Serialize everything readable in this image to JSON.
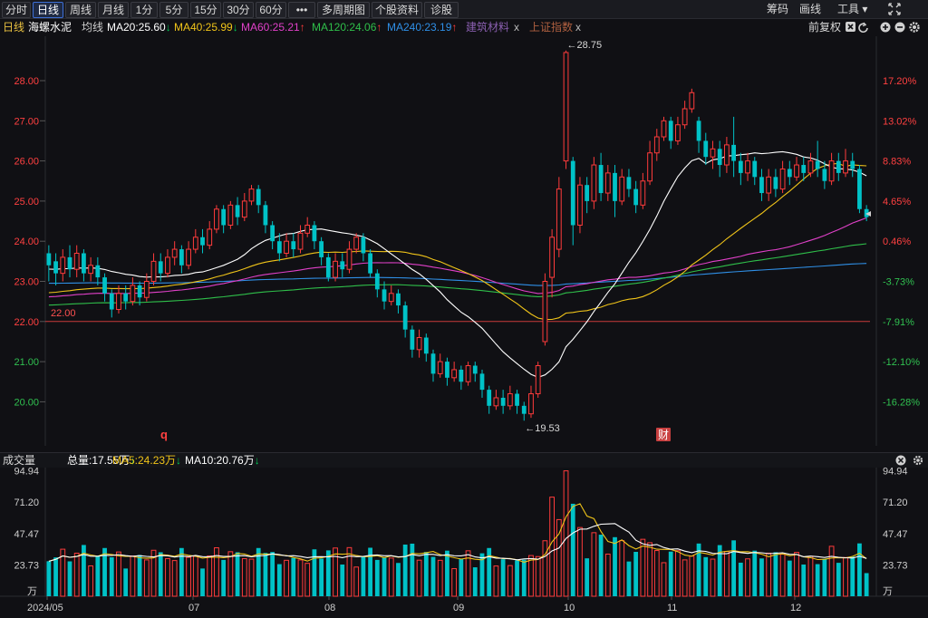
{
  "toolbar": {
    "left_buttons": [
      "分时",
      "日线",
      "周线",
      "月线",
      "1分",
      "5分",
      "15分",
      "30分",
      "60分",
      "•••",
      "多周期图 ▾",
      "个股资料",
      "诊股"
    ],
    "active_index": 1,
    "right_items": [
      "筹码",
      "画线",
      "工具 ▾"
    ],
    "expand_icon": "expand-arrows-icon"
  },
  "info": {
    "period": "日线",
    "stock_name": "海螺水泥",
    "ma_label": "均线",
    "ma20": "MA20:25.60",
    "ma20_arrow": "↓",
    "ma40": "MA40:25.99",
    "ma40_arrow": "↓",
    "ma60": "MA60:25.21",
    "ma60_arrow": "↑",
    "ma120": "MA120:24.06",
    "ma120_arrow": "↑",
    "ma240": "MA240:23.19",
    "ma240_arrow": "↑",
    "overlay1": "建筑材料",
    "overlay1_close": "x",
    "overlay2": "上证指数",
    "overlay2_close": "x",
    "adjust": "前复权",
    "colors": {
      "ma20": "#ffffff",
      "ma40": "#f0c419",
      "ma60": "#e040c8",
      "ma120": "#2fbf4a",
      "ma240": "#2f8fe6",
      "up": "#ff3b3b",
      "down": "#00c2c7"
    }
  },
  "price_axis": {
    "left_labels": [
      "28.00",
      "27.00",
      "26.00",
      "25.00",
      "24.00",
      "23.00",
      "22.00",
      "21.00",
      "20.00"
    ],
    "right_labels": [
      "17.20%",
      "13.02%",
      "8.83%",
      "4.65%",
      "0.46%",
      "-3.73%",
      "-7.91%",
      "-12.10%",
      "-16.28%"
    ],
    "ref_line": "22.00",
    "high_marker": "←28.75",
    "low_marker": "←19.53",
    "q_marker": "q",
    "cai_marker": "财"
  },
  "volume": {
    "title": "成交量",
    "total": "总量:17.55万",
    "total_arrow": "↓",
    "ma5": "MA5:24.23万",
    "ma5_arrow": "↓",
    "ma10": "MA10:20.76万",
    "ma10_arrow": "↓",
    "axis_labels": [
      "94.94",
      "71.20",
      "47.47",
      "23.73",
      "万"
    ]
  },
  "x_axis": [
    "2024/05",
    "07",
    "08",
    "09",
    "10",
    "11",
    "12"
  ],
  "chart_data": {
    "type": "candlestick",
    "title": "海螺水泥",
    "ylim": [
      19.4,
      29.0
    ],
    "reference_line": 22.0,
    "high": 28.75,
    "low": 19.53,
    "candles": [
      [
        23.7,
        23.4,
        23.9,
        23.0
      ],
      [
        23.5,
        23.2,
        23.7,
        22.9
      ],
      [
        23.2,
        23.6,
        23.8,
        23.0
      ],
      [
        23.6,
        23.3,
        23.9,
        23.1
      ],
      [
        23.3,
        23.7,
        23.9,
        23.1
      ],
      [
        23.7,
        23.2,
        23.8,
        23.0
      ],
      [
        23.2,
        23.4,
        23.6,
        23.0
      ],
      [
        23.4,
        23.1,
        23.6,
        22.9
      ],
      [
        23.1,
        22.7,
        23.2,
        22.5
      ],
      [
        22.7,
        22.3,
        22.8,
        22.1
      ],
      [
        22.3,
        22.7,
        22.9,
        22.2
      ],
      [
        22.7,
        22.5,
        22.9,
        22.3
      ],
      [
        22.5,
        22.9,
        23.1,
        22.4
      ],
      [
        22.9,
        22.6,
        23.0,
        22.4
      ],
      [
        22.6,
        23.0,
        23.2,
        22.5
      ],
      [
        23.0,
        23.5,
        23.7,
        22.9
      ],
      [
        23.5,
        23.2,
        23.7,
        23.0
      ],
      [
        23.2,
        23.6,
        23.8,
        23.1
      ],
      [
        23.6,
        23.8,
        24.0,
        23.4
      ],
      [
        23.8,
        23.4,
        23.9,
        23.2
      ],
      [
        23.4,
        23.8,
        24.0,
        23.3
      ],
      [
        23.8,
        24.1,
        24.3,
        23.7
      ],
      [
        24.1,
        23.9,
        24.3,
        23.7
      ],
      [
        23.9,
        24.3,
        24.5,
        23.8
      ],
      [
        24.3,
        24.8,
        24.9,
        24.2
      ],
      [
        24.8,
        24.4,
        24.9,
        24.2
      ],
      [
        24.4,
        24.9,
        25.0,
        24.3
      ],
      [
        24.9,
        24.6,
        25.1,
        24.4
      ],
      [
        24.6,
        25.0,
        25.2,
        24.5
      ],
      [
        25.0,
        25.3,
        25.4,
        24.9
      ],
      [
        25.3,
        24.9,
        25.4,
        24.7
      ],
      [
        24.9,
        24.4,
        25.0,
        24.2
      ],
      [
        24.4,
        24.0,
        24.5,
        23.8
      ],
      [
        24.0,
        23.7,
        24.2,
        23.5
      ],
      [
        23.7,
        24.0,
        24.2,
        23.6
      ],
      [
        24.0,
        23.8,
        24.2,
        23.6
      ],
      [
        23.8,
        24.2,
        24.4,
        23.7
      ],
      [
        24.2,
        24.4,
        24.6,
        24.1
      ],
      [
        24.4,
        24.0,
        24.5,
        23.8
      ],
      [
        24.0,
        23.6,
        24.1,
        23.4
      ],
      [
        23.6,
        23.1,
        23.7,
        23.0
      ],
      [
        23.1,
        23.5,
        23.7,
        23.0
      ],
      [
        23.5,
        23.3,
        23.7,
        23.1
      ],
      [
        23.3,
        23.8,
        24.0,
        23.2
      ],
      [
        23.8,
        24.1,
        24.2,
        23.7
      ],
      [
        24.1,
        23.7,
        24.2,
        23.5
      ],
      [
        23.7,
        23.2,
        23.8,
        23.1
      ],
      [
        23.2,
        22.8,
        23.3,
        22.6
      ],
      [
        22.8,
        22.5,
        23.0,
        22.3
      ],
      [
        22.5,
        22.7,
        22.9,
        22.4
      ],
      [
        22.7,
        22.4,
        22.8,
        22.2
      ],
      [
        22.4,
        21.8,
        22.5,
        21.6
      ],
      [
        21.8,
        21.3,
        21.9,
        21.1
      ],
      [
        21.3,
        21.6,
        21.8,
        21.1
      ],
      [
        21.6,
        21.2,
        21.7,
        21.0
      ],
      [
        21.2,
        20.7,
        21.3,
        20.5
      ],
      [
        20.7,
        21.0,
        21.2,
        20.6
      ],
      [
        21.0,
        20.6,
        21.1,
        20.4
      ],
      [
        20.6,
        20.8,
        21.0,
        20.5
      ],
      [
        20.8,
        20.5,
        20.9,
        20.3
      ],
      [
        20.5,
        20.9,
        21.0,
        20.4
      ],
      [
        20.9,
        20.7,
        21.0,
        20.5
      ],
      [
        20.7,
        20.3,
        20.8,
        20.1
      ],
      [
        20.3,
        19.9,
        20.4,
        19.7
      ],
      [
        19.9,
        20.1,
        20.3,
        19.8
      ],
      [
        20.1,
        19.9,
        20.3,
        19.7
      ],
      [
        19.9,
        20.2,
        20.4,
        19.8
      ],
      [
        20.2,
        19.9,
        20.3,
        19.7
      ],
      [
        19.9,
        19.7,
        20.0,
        19.53
      ],
      [
        19.7,
        20.2,
        20.4,
        19.6
      ],
      [
        20.2,
        20.9,
        21.0,
        20.1
      ],
      [
        21.5,
        23.0,
        23.2,
        21.4
      ],
      [
        23.1,
        24.1,
        24.3,
        22.6
      ],
      [
        23.8,
        25.3,
        25.6,
        23.6
      ],
      [
        26.0,
        28.7,
        28.75,
        25.8
      ],
      [
        26.0,
        24.4,
        26.1,
        23.9
      ],
      [
        24.4,
        25.4,
        25.6,
        24.2
      ],
      [
        25.4,
        25.0,
        25.6,
        24.7
      ],
      [
        25.0,
        25.9,
        26.1,
        24.8
      ],
      [
        25.9,
        25.2,
        26.2,
        25.0
      ],
      [
        25.2,
        25.7,
        25.9,
        25.0
      ],
      [
        25.7,
        25.0,
        25.9,
        24.6
      ],
      [
        25.0,
        25.6,
        25.8,
        24.9
      ],
      [
        25.6,
        25.3,
        25.8,
        25.1
      ],
      [
        25.3,
        24.9,
        25.5,
        24.7
      ],
      [
        24.9,
        25.5,
        25.7,
        24.8
      ],
      [
        25.5,
        26.2,
        26.5,
        25.4
      ],
      [
        26.2,
        26.6,
        26.8,
        26.0
      ],
      [
        26.6,
        27.0,
        27.1,
        26.5
      ],
      [
        27.0,
        26.5,
        27.1,
        26.3
      ],
      [
        26.5,
        26.9,
        27.1,
        26.4
      ],
      [
        26.9,
        27.3,
        27.5,
        26.8
      ],
      [
        27.3,
        27.7,
        27.8,
        27.2
      ],
      [
        27.0,
        26.5,
        27.1,
        26.2
      ],
      [
        26.5,
        26.1,
        26.7,
        25.9
      ],
      [
        26.1,
        26.3,
        26.5,
        25.8
      ],
      [
        26.3,
        25.9,
        26.5,
        25.6
      ],
      [
        25.9,
        26.4,
        26.6,
        25.7
      ],
      [
        26.4,
        26.0,
        27.1,
        25.6
      ],
      [
        26.0,
        25.7,
        26.2,
        25.4
      ],
      [
        25.7,
        26.0,
        26.2,
        25.5
      ],
      [
        26.0,
        25.6,
        26.1,
        25.4
      ],
      [
        25.6,
        25.2,
        25.8,
        25.0
      ],
      [
        25.2,
        25.6,
        25.8,
        25.0
      ],
      [
        25.6,
        25.3,
        25.8,
        25.1
      ],
      [
        25.3,
        25.8,
        26.0,
        25.2
      ],
      [
        25.8,
        25.6,
        26.0,
        25.4
      ],
      [
        25.6,
        25.9,
        26.1,
        25.5
      ],
      [
        25.9,
        25.7,
        26.1,
        25.5
      ],
      [
        25.7,
        26.0,
        26.2,
        25.6
      ],
      [
        26.0,
        25.8,
        26.5,
        25.6
      ],
      [
        25.8,
        25.5,
        26.0,
        25.3
      ],
      [
        25.5,
        26.0,
        26.2,
        25.4
      ],
      [
        26.0,
        25.7,
        26.2,
        25.5
      ],
      [
        25.7,
        26.0,
        26.3,
        25.6
      ],
      [
        26.0,
        25.8,
        26.2,
        25.6
      ],
      [
        25.8,
        24.8,
        25.9,
        24.7
      ],
      [
        24.8,
        24.6,
        24.9,
        24.5
      ]
    ],
    "volume_ylim": [
      0,
      96
    ],
    "volume_ticks": [
      23.73,
      47.47,
      71.2,
      94.94
    ]
  }
}
